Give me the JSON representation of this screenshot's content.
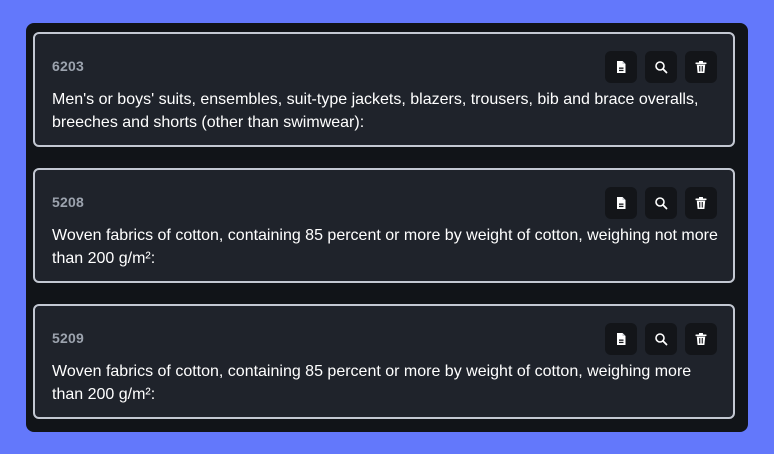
{
  "colors": {
    "page_background": "#6378fb",
    "panel_background": "#111418",
    "card_background": "#1f232b",
    "card_border": "#c3c8d2",
    "code_text": "#9ca3ae",
    "description_text": "#ffffff",
    "icon": "#ffffff"
  },
  "cards": [
    {
      "code": "6203",
      "description": "Men's or boys' suits, ensembles, suit-type jackets, blazers, trousers, bib and brace overalls,   breeches and shorts (other than swimwear):",
      "actions": [
        "document-icon",
        "search-icon",
        "trash-icon"
      ]
    },
    {
      "code": "5208",
      "description": "Woven fabrics of cotton, containing 85 percent or more by weight of cotton, weighing not more than 200 g/m²:",
      "actions": [
        "document-icon",
        "search-icon",
        "trash-icon"
      ]
    },
    {
      "code": "5209",
      "description": "Woven fabrics of cotton, containing 85 percent or more by weight of cotton, weighing more than 200 g/m²:",
      "actions": [
        "document-icon",
        "search-icon",
        "trash-icon"
      ]
    }
  ]
}
